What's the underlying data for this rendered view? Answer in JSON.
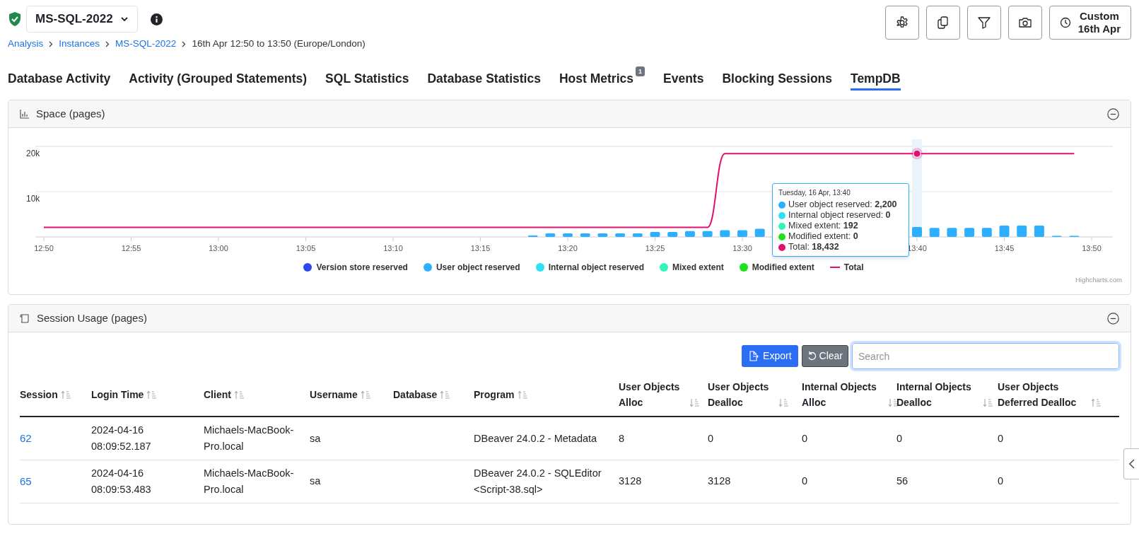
{
  "instance": {
    "name": "MS-SQL-2022",
    "healthy": true
  },
  "breadcrumb": [
    {
      "label": "Analysis",
      "kind": "link"
    },
    {
      "label": "Instances",
      "kind": "link"
    },
    {
      "label": "MS-SQL-2022",
      "kind": "link"
    },
    {
      "label": "16th Apr 12:50 to 13:50 (Europe/London)",
      "kind": "text"
    }
  ],
  "toolbar": [
    {
      "kind": "settings"
    },
    {
      "kind": "copy"
    },
    {
      "kind": "filter"
    },
    {
      "kind": "camera"
    }
  ],
  "time_range": {
    "line_1": "Custom",
    "line_2": "16th Apr"
  },
  "tabs": [
    {
      "label": "Database Activity",
      "selected": false
    },
    {
      "label": "Activity (Grouped Statements)",
      "selected": false
    },
    {
      "label": "SQL Statistics",
      "selected": false
    },
    {
      "label": "Database Statistics",
      "selected": false
    },
    {
      "label": "Host Metrics",
      "badge": "1",
      "selected": false
    },
    {
      "label": "Events",
      "selected": false
    },
    {
      "label": "Blocking Sessions",
      "selected": false
    },
    {
      "label": "TempDB",
      "selected": true
    }
  ],
  "space_panel": {
    "title": "Space (pages)",
    "chart_data": {
      "type": "bar",
      "categories": [
        "12:50",
        null,
        null,
        null,
        null,
        "12:55",
        null,
        null,
        null,
        null,
        "13:00",
        null,
        null,
        null,
        null,
        "13:05",
        null,
        null,
        null,
        null,
        "13:10",
        null,
        null,
        null,
        null,
        "13:15",
        null,
        null,
        null,
        null,
        "13:20",
        null,
        null,
        null,
        null,
        "13:25",
        null,
        null,
        null,
        null,
        "13:30",
        null,
        null,
        null,
        null,
        null,
        null,
        null,
        null,
        null,
        "13:40",
        null,
        null,
        null,
        null,
        "13:45",
        null,
        null,
        null,
        null,
        "13:50"
      ],
      "yticks": [
        {
          "value": 10000,
          "label": "10k"
        },
        {
          "value": 20000,
          "label": "20k"
        }
      ],
      "ylim": [
        0,
        20000
      ],
      "series": [
        {
          "name": "Version store reserved",
          "color": "#2b47f0",
          "type": "bar",
          "values": [
            null,
            null,
            null,
            null,
            null,
            null,
            null,
            null,
            null,
            null,
            null,
            null,
            null,
            null,
            null,
            null,
            null,
            null,
            null,
            null,
            null,
            null,
            null,
            null,
            null,
            null,
            null,
            null,
            null,
            null,
            null,
            null,
            null,
            null,
            null,
            null,
            null,
            null,
            null,
            null,
            null,
            null,
            null,
            null,
            null,
            null,
            null,
            null,
            null,
            null,
            null,
            null,
            null,
            null,
            null,
            null,
            null,
            null,
            null,
            null,
            null
          ]
        },
        {
          "name": "User object reserved",
          "color": "#2caffe",
          "type": "bar",
          "values": [
            null,
            null,
            null,
            null,
            null,
            null,
            null,
            null,
            null,
            null,
            null,
            null,
            null,
            null,
            null,
            null,
            null,
            null,
            null,
            null,
            null,
            null,
            null,
            null,
            null,
            null,
            null,
            null,
            300,
            800,
            800,
            800,
            800,
            800,
            800,
            1100,
            1100,
            1300,
            1300,
            1500,
            1500,
            1800,
            null,
            null,
            null,
            null,
            null,
            null,
            null,
            null,
            2200,
            2000,
            2000,
            2000,
            2000,
            2500,
            2500,
            2500,
            100,
            100,
            null
          ]
        },
        {
          "name": "Internal object reserved",
          "color": "#2ee0f5",
          "type": "bar",
          "values": [
            null,
            null,
            null,
            null,
            null,
            null,
            null,
            null,
            null,
            null,
            null,
            null,
            null,
            null,
            null,
            null,
            null,
            null,
            null,
            null,
            null,
            null,
            null,
            null,
            null,
            null,
            null,
            null,
            null,
            null,
            null,
            null,
            null,
            null,
            null,
            null,
            null,
            null,
            null,
            null,
            null,
            null,
            null,
            null,
            null,
            null,
            null,
            null,
            null,
            null,
            null,
            null,
            null,
            null,
            null,
            null,
            null,
            null,
            null,
            null,
            null
          ]
        },
        {
          "name": "Mixed extent",
          "color": "#2ef5bb",
          "type": "bar",
          "values": [
            null,
            null,
            null,
            null,
            null,
            null,
            null,
            null,
            null,
            null,
            null,
            null,
            null,
            null,
            null,
            null,
            null,
            null,
            null,
            null,
            null,
            null,
            null,
            null,
            null,
            null,
            null,
            null,
            null,
            null,
            null,
            null,
            null,
            null,
            null,
            null,
            null,
            null,
            null,
            null,
            null,
            null,
            null,
            null,
            null,
            null,
            null,
            null,
            null,
            null,
            null,
            null,
            null,
            null,
            null,
            null,
            null,
            null,
            null,
            null,
            null
          ]
        },
        {
          "name": "Modified extent",
          "color": "#1fe01f",
          "type": "bar",
          "values": [
            null,
            null,
            null,
            null,
            null,
            null,
            null,
            null,
            null,
            null,
            null,
            null,
            null,
            null,
            null,
            null,
            null,
            null,
            null,
            null,
            null,
            null,
            null,
            null,
            null,
            null,
            null,
            null,
            null,
            null,
            null,
            null,
            null,
            null,
            null,
            null,
            null,
            null,
            null,
            null,
            null,
            null,
            null,
            null,
            null,
            null,
            null,
            null,
            null,
            null,
            null,
            null,
            null,
            null,
            null,
            null,
            null,
            null,
            null,
            null,
            null
          ]
        },
        {
          "name": "Total",
          "color": "#e0106f",
          "type": "line",
          "values": [
            2100,
            2100,
            2100,
            2100,
            2100,
            2100,
            2100,
            2100,
            2100,
            2100,
            2100,
            2100,
            2100,
            2100,
            2100,
            2100,
            2100,
            2100,
            2100,
            2100,
            2100,
            2100,
            2100,
            2100,
            2100,
            2100,
            2100,
            2100,
            2100,
            2100,
            2100,
            2100,
            2100,
            2100,
            2100,
            2100,
            2100,
            2100,
            2100,
            18400,
            18400,
            18400,
            18400,
            18400,
            18400,
            18400,
            18400,
            18400,
            18400,
            18400,
            18400,
            18400,
            18400,
            18400,
            18400,
            18400,
            18400,
            18400,
            18400,
            18400,
            null
          ]
        }
      ]
    },
    "tooltip": {
      "title": "Tuesday, 16 Apr, 13:40",
      "rows": [
        {
          "text": "User object reserved: **2,200**",
          "color": "#2caffe"
        },
        {
          "text": "Internal object reserved: **0**",
          "color": "#2ee0f5"
        },
        {
          "text": "Mixed extent: **192**",
          "color": "#2ef5bb"
        },
        {
          "text": "Modified extent: **0**",
          "color": "#1fe01f"
        },
        {
          "text": "Total: **18,432**",
          "color": "#e0106f"
        }
      ]
    },
    "credit": "Highcharts.com"
  },
  "session_panel": {
    "title": "Session Usage (pages)",
    "export": "Export",
    "clear": "Clear",
    "search": {
      "placeholder": "Search"
    },
    "columns": [
      {
        "label": "Session",
        "descending": false
      },
      {
        "label": "Login Time",
        "descending": false
      },
      {
        "label": "Client",
        "descending": false
      },
      {
        "label": "Username",
        "descending": false
      },
      {
        "label": "Database",
        "descending": false
      },
      {
        "label": "Program",
        "descending": false
      },
      {
        "label": "User Objects Alloc",
        "descending": true
      },
      {
        "label": "User Objects Dealloc",
        "descending": true
      },
      {
        "label": "Internal Objects Alloc",
        "descending": true
      },
      {
        "label": "Internal Objects Dealloc",
        "descending": true
      },
      {
        "label": "User Objects Deferred Dealloc",
        "descending": false
      }
    ],
    "rows": [
      {
        "cells": [
          "62",
          "2024-04-16 08:09:52.187",
          "Michaels-MacBook-Pro.local",
          "sa",
          "",
          "DBeaver 24.0.2 - Metadata",
          "8",
          "0",
          "0",
          "0",
          "0"
        ]
      },
      {
        "cells": [
          "65",
          "2024-04-16 08:09:53.483",
          "Michaels-MacBook-Pro.local",
          "sa",
          "",
          "DBeaver 24.0.2 - SQLEditor <Script-38.sql>",
          "3128",
          "3128",
          "0",
          "56",
          "0"
        ]
      }
    ]
  }
}
